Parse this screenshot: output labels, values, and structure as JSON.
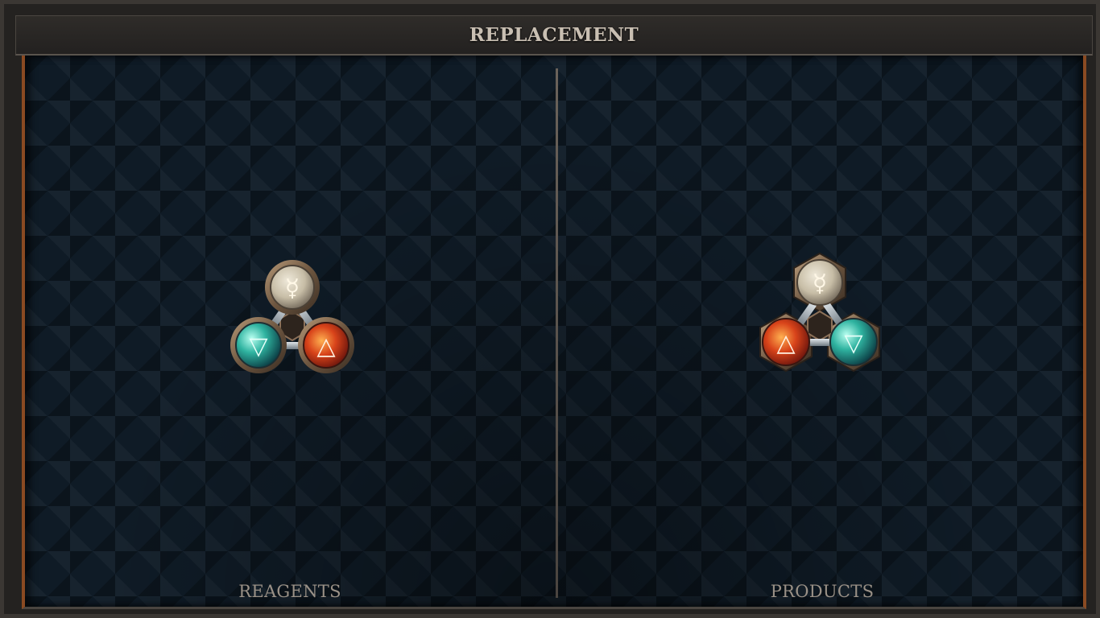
{
  "window": {
    "title": "REPLACEMENT"
  },
  "panels": {
    "left": {
      "label": "REAGENTS",
      "molecule": {
        "top": "mercury-orb",
        "bottom_left": "water-orb",
        "bottom_right": "fire-orb"
      }
    },
    "right": {
      "label": "PRODUCTS",
      "molecule": {
        "top": "mercury-orb",
        "bottom_left": "fire-orb",
        "bottom_right": "water-orb"
      }
    }
  },
  "symbols": {
    "mercury": "☿",
    "water": "▽",
    "fire": "△"
  },
  "colors": {
    "frame": "#242220",
    "border_accent": "#8a4a22",
    "board": "#0f1b26",
    "title_text": "#c9bfb2",
    "label_text": "#9a9187",
    "water": "#2fb3a0",
    "fire": "#d8431a",
    "mercury": "#d8d0bd"
  }
}
